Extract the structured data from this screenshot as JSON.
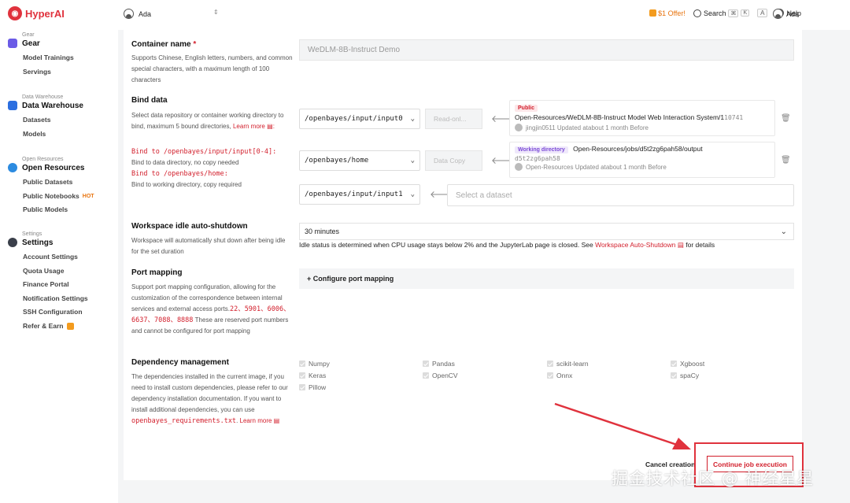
{
  "app": {
    "brand": "HyperAI"
  },
  "topbar": {
    "user": "Ada",
    "offer": "$1 Offer!",
    "search_label": "Search",
    "search_keys": [
      "⌘",
      "K"
    ],
    "lang_label": "A",
    "help_label": "Help",
    "top_user": "Ada"
  },
  "sidebar": {
    "groups": [
      {
        "caption": "Gear",
        "title": "Gear",
        "items": [
          "Model Trainings",
          "Servings"
        ]
      },
      {
        "caption": "Data Warehouse",
        "title": "Data Warehouse",
        "items": [
          "Datasets",
          "Models"
        ]
      },
      {
        "caption": "Open Resources",
        "title": "Open Resources",
        "items": [
          "Public Datasets",
          "Public Notebooks",
          "Public Models"
        ],
        "hot": "HOT"
      },
      {
        "caption": "Settings",
        "title": "Settings",
        "items": [
          "Account Settings",
          "Quota Usage",
          "Finance Portal",
          "Notification Settings",
          "SSH Configuration",
          "Refer & Earn"
        ]
      }
    ]
  },
  "form": {
    "container_name": {
      "title": "Container name",
      "required_mark": "*",
      "desc": "Supports Chinese, English letters, numbers, and common special characters, with a maximum length of 100 characters",
      "value": "WeDLM-8B-Instruct Demo"
    },
    "bind_data": {
      "title": "Bind data",
      "desc": "Select data repository or container working directory to bind, maximum 5 bound directories,",
      "learn_more": "Learn more",
      "rule1_code": "Bind to /openbayes/input/input[0-4]:",
      "rule1_text": "Bind to data directory, no copy needed",
      "rule2_code": "Bind to /openbayes/home:",
      "rule2_text": "Bind to working directory, copy required",
      "rows": [
        {
          "path": "/openbayes/input/input0",
          "mode": "Read-onl...",
          "tag": "Public",
          "resource": "Open-Resources/WeDLM-8B-Instruct Model Web Interaction System/1",
          "resource_suffix": "10741",
          "meta": "jingjin0511 Updated atabout 1 month Before"
        },
        {
          "path": "/openbayes/home",
          "mode": "Data Copy",
          "tag": "Working directory",
          "resource": "Open-Resources/jobs/d5t2zg6pah58/output",
          "resource_id": "d5t2zg6pah58",
          "meta": "Open-Resources Updated atabout 1 month Before"
        },
        {
          "path": "/openbayes/input/input1",
          "placeholder": "Select a dataset"
        }
      ]
    },
    "idle": {
      "title": "Workspace idle auto-shutdown",
      "desc": "Workspace will automatically shut down after being idle for the set duration",
      "value": "30 minutes",
      "note": "Idle status is determined when CPU usage stays below 2% and the JupyterLab page is closed. See",
      "note_link": "Workspace Auto-Shutdown",
      "note_tail": "for details"
    },
    "port": {
      "title": "Port mapping",
      "desc": "Support port mapping configuration, allowing for the customization of the correspondence between internal services and external access ports.",
      "ports": "22、5901、6006、6637、7088、8888",
      "desc2": "These are reserved port numbers and cannot be configured for port mapping",
      "configure_label": "+ Configure port mapping"
    },
    "deps": {
      "title": "Dependency management",
      "desc": "The dependencies installed in the current image, if you need to install custom dependencies, please refer to our dependency installation documentation. If you want to install additional dependencies, you can use",
      "file": "openbayes_requirements.txt",
      "learn_more": "Learn more",
      "items": [
        "Numpy",
        "Pandas",
        "scikit-learn",
        "Xgboost",
        "Keras",
        "OpenCV",
        "Onnx",
        "spaCy",
        "Pillow"
      ]
    },
    "actions": {
      "cancel": "Cancel creation",
      "continue": "Continue job execution"
    }
  },
  "watermark": "掘金技术社区 @ 神经星星",
  "colors": {
    "accent": "#d21e2b",
    "offer": "#e8730d"
  }
}
